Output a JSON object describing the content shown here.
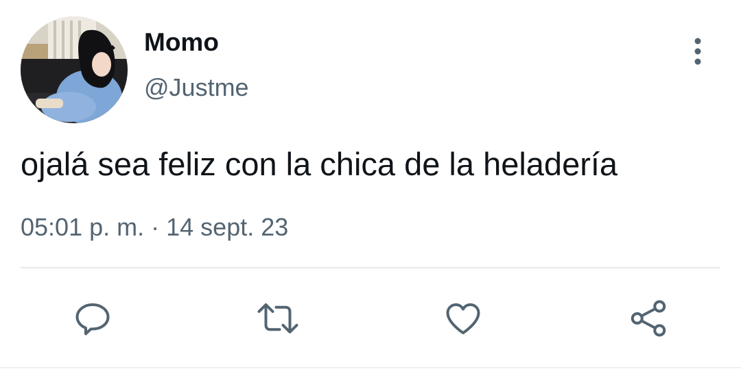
{
  "tweet": {
    "author": {
      "display_name": "Momo",
      "handle": "@Justme",
      "avatar": "profile-photo"
    },
    "text": "ojalá sea feliz con la chica de la heladería",
    "time": "05:01 p. m.",
    "separator": "·",
    "date": "14 sept. 23"
  },
  "icons": {
    "more": "more-vertical-icon",
    "reply": "reply-icon",
    "retweet": "retweet-icon",
    "like": "heart-icon",
    "share": "share-icon"
  },
  "colors": {
    "text_primary": "#0f1419",
    "text_secondary": "#536471",
    "divider": "#e7e9ea"
  }
}
